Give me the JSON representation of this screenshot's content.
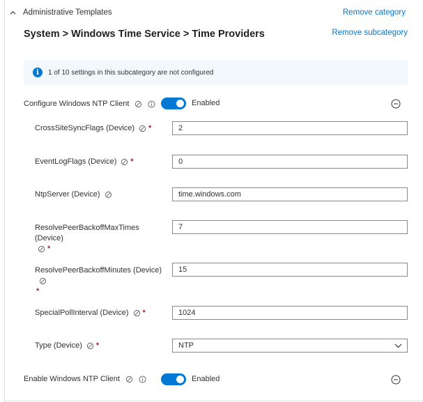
{
  "category": {
    "title": "Administrative Templates",
    "remove_category": "Remove category",
    "remove_subcategory": "Remove subcategory",
    "breadcrumb": "System > Windows Time Service > Time Providers"
  },
  "info_bar": {
    "icon": "info-icon",
    "text": "1 of 10 settings in this subcategory are not configured"
  },
  "settings": [
    {
      "label": "Configure Windows NTP Client",
      "state": "Enabled",
      "toggle_on": true
    },
    {
      "label": "Enable Windows NTP Client",
      "state": "Enabled",
      "toggle_on": true
    }
  ],
  "fields": [
    {
      "label": "CrossSiteSyncFlags (Device)",
      "required": "*",
      "value": "2"
    },
    {
      "label": "EventLogFlags (Device)",
      "required": "*",
      "value": "0"
    },
    {
      "label": "NtpServer (Device)",
      "required": "",
      "value": "time.windows.com"
    },
    {
      "label": "ResolvePeerBackoffMaxTimes (Device)",
      "required": "*",
      "value": "7"
    },
    {
      "label": "ResolvePeerBackoffMinutes (Device)",
      "required": "*",
      "value": "15"
    },
    {
      "label": "SpecialPollInterval (Device)",
      "required": "*",
      "value": "1024"
    },
    {
      "label": "Type (Device)",
      "required": "*",
      "value": "NTP"
    }
  ],
  "colors": {
    "accent": "#0078d4",
    "required": "#a4262c",
    "info_background": "#f3f8fd"
  }
}
